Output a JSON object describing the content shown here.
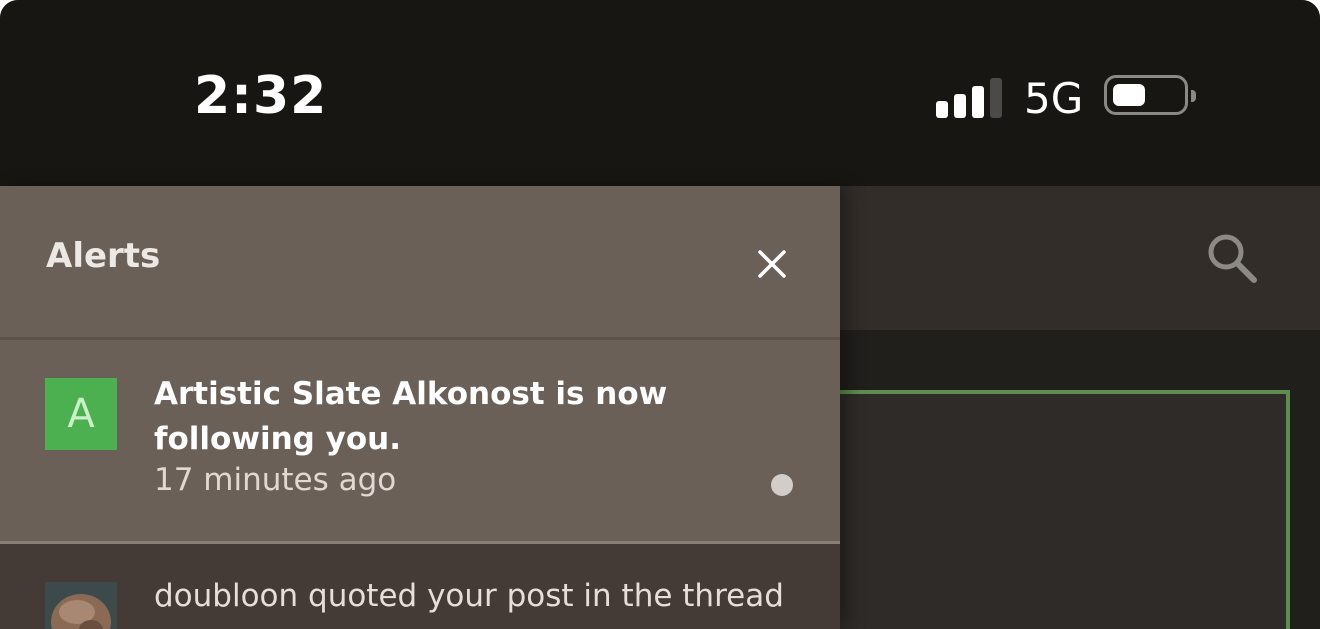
{
  "status_bar": {
    "time": "2:32",
    "network": "5G",
    "signal_bars_active": 3,
    "signal_bars_total": 4,
    "battery_level_percent": 45
  },
  "alerts": {
    "title": "Alerts",
    "items": [
      {
        "avatar_letter": "A",
        "text": "Artistic Slate Alkonost is now following you.",
        "time": "17 minutes ago",
        "unread": true
      },
      {
        "text": "doubloon quoted your post in the thread",
        "unread": false
      }
    ]
  },
  "colors": {
    "panel_bg": "#6b6058",
    "avatar_green": "#4caf50",
    "card_border": "#5e8c4f",
    "status_bar_bg": "#181613"
  },
  "icons": {
    "close": "close-icon",
    "search": "search-icon",
    "unread": "unread-dot-icon"
  }
}
